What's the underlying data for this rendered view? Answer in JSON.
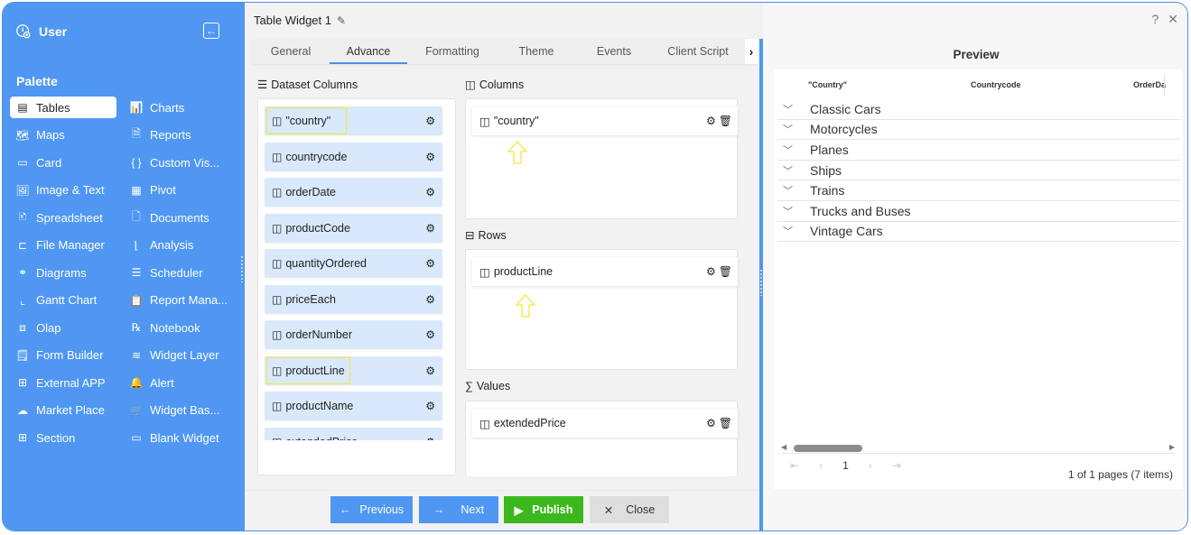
{
  "sidebar": {
    "user_label": "User",
    "palette_label": "Palette",
    "items": [
      {
        "label": "Tables",
        "icon": "table-icon",
        "glyph": "▤",
        "active": true
      },
      {
        "label": "Charts",
        "icon": "chart-icon",
        "glyph": "📊"
      },
      {
        "label": "Maps",
        "icon": "map-icon",
        "glyph": "🗺"
      },
      {
        "label": "Reports",
        "icon": "report-icon",
        "glyph": "🗎"
      },
      {
        "label": "Card",
        "icon": "card-icon",
        "glyph": "▭"
      },
      {
        "label": "Custom Vis...",
        "icon": "braces-icon",
        "glyph": "{ }"
      },
      {
        "label": "Image & Text",
        "icon": "image-icon",
        "glyph": "🖼"
      },
      {
        "label": "Pivot",
        "icon": "pivot-icon",
        "glyph": "▦"
      },
      {
        "label": "Spreadsheet",
        "icon": "spreadsheet-icon",
        "glyph": "🗈"
      },
      {
        "label": "Documents",
        "icon": "document-icon",
        "glyph": "🗋"
      },
      {
        "label": "File Manager",
        "icon": "file-manager-icon",
        "glyph": "⊏"
      },
      {
        "label": "Analysis",
        "icon": "analysis-icon",
        "glyph": "⌊"
      },
      {
        "label": "Diagrams",
        "icon": "diagram-icon",
        "glyph": "⚭"
      },
      {
        "label": "Scheduler",
        "icon": "scheduler-icon",
        "glyph": "☰"
      },
      {
        "label": "Gantt Chart",
        "icon": "gantt-icon",
        "glyph": "⌞"
      },
      {
        "label": "Report Mana...",
        "icon": "clipboard-icon",
        "glyph": "📋"
      },
      {
        "label": "Olap",
        "icon": "olap-cube-icon",
        "glyph": "⧈"
      },
      {
        "label": "Notebook",
        "icon": "rx-icon",
        "glyph": "℞"
      },
      {
        "label": "Form Builder",
        "icon": "form-icon",
        "glyph": "🗒"
      },
      {
        "label": "Widget Layer",
        "icon": "layers-icon",
        "glyph": "≋"
      },
      {
        "label": "External APP",
        "icon": "apps-icon",
        "glyph": "⊞"
      },
      {
        "label": "Alert",
        "icon": "alert-bell-icon",
        "glyph": "🔔"
      },
      {
        "label": "Market Place",
        "icon": "cloud-upload-icon",
        "glyph": "☁"
      },
      {
        "label": "Widget Bas...",
        "icon": "cart-icon",
        "glyph": "🛒"
      },
      {
        "label": "Section",
        "icon": "section-grid-icon",
        "glyph": "⊞"
      },
      {
        "label": "Blank Widget",
        "icon": "blank-widget-icon",
        "glyph": "▭"
      }
    ]
  },
  "editor": {
    "title": "Table Widget 1",
    "tabs": [
      {
        "label": "General"
      },
      {
        "label": "Advance",
        "active": true
      },
      {
        "label": "Formatting"
      },
      {
        "label": "Theme"
      },
      {
        "label": "Events"
      },
      {
        "label": "Client Script"
      }
    ],
    "dataset_label": "Dataset Columns",
    "dataset_columns": [
      {
        "label": "\"country\"",
        "highlighted": true
      },
      {
        "label": "countrycode"
      },
      {
        "label": "orderDate"
      },
      {
        "label": "productCode"
      },
      {
        "label": "quantityOrdered"
      },
      {
        "label": "priceEach"
      },
      {
        "label": "orderNumber"
      },
      {
        "label": "productLine",
        "highlighted": true
      },
      {
        "label": "productName"
      },
      {
        "label": "extendedPrice"
      }
    ],
    "columns_label": "Columns",
    "columns_items": [
      "\"country\""
    ],
    "rows_label": "Rows",
    "rows_items": [
      "productLine"
    ],
    "values_label": "Values",
    "values_items": [
      "extendedPrice"
    ],
    "buttons": {
      "previous": "Previous",
      "next": "Next",
      "publish": "Publish",
      "close": "Close"
    }
  },
  "preview": {
    "title": "Preview",
    "headers": [
      "\"Country\"",
      "Countrycode",
      "OrderDa"
    ],
    "rows": [
      "Classic Cars",
      "Motorcycles",
      "Planes",
      "Ships",
      "Trains",
      "Trucks and Buses",
      "Vintage Cars"
    ],
    "pager": {
      "current_page": "1",
      "info": "1 of 1 pages (7 items)"
    }
  },
  "window": {
    "help": "?",
    "close": "✕"
  },
  "colors": {
    "sidebar_bg": "#4f97f2",
    "accent": "#4a90e2",
    "publish_green": "#3cb81e",
    "dataset_item_bg": "#d9e9fb",
    "highlight_yellow": "#f0e83a"
  }
}
